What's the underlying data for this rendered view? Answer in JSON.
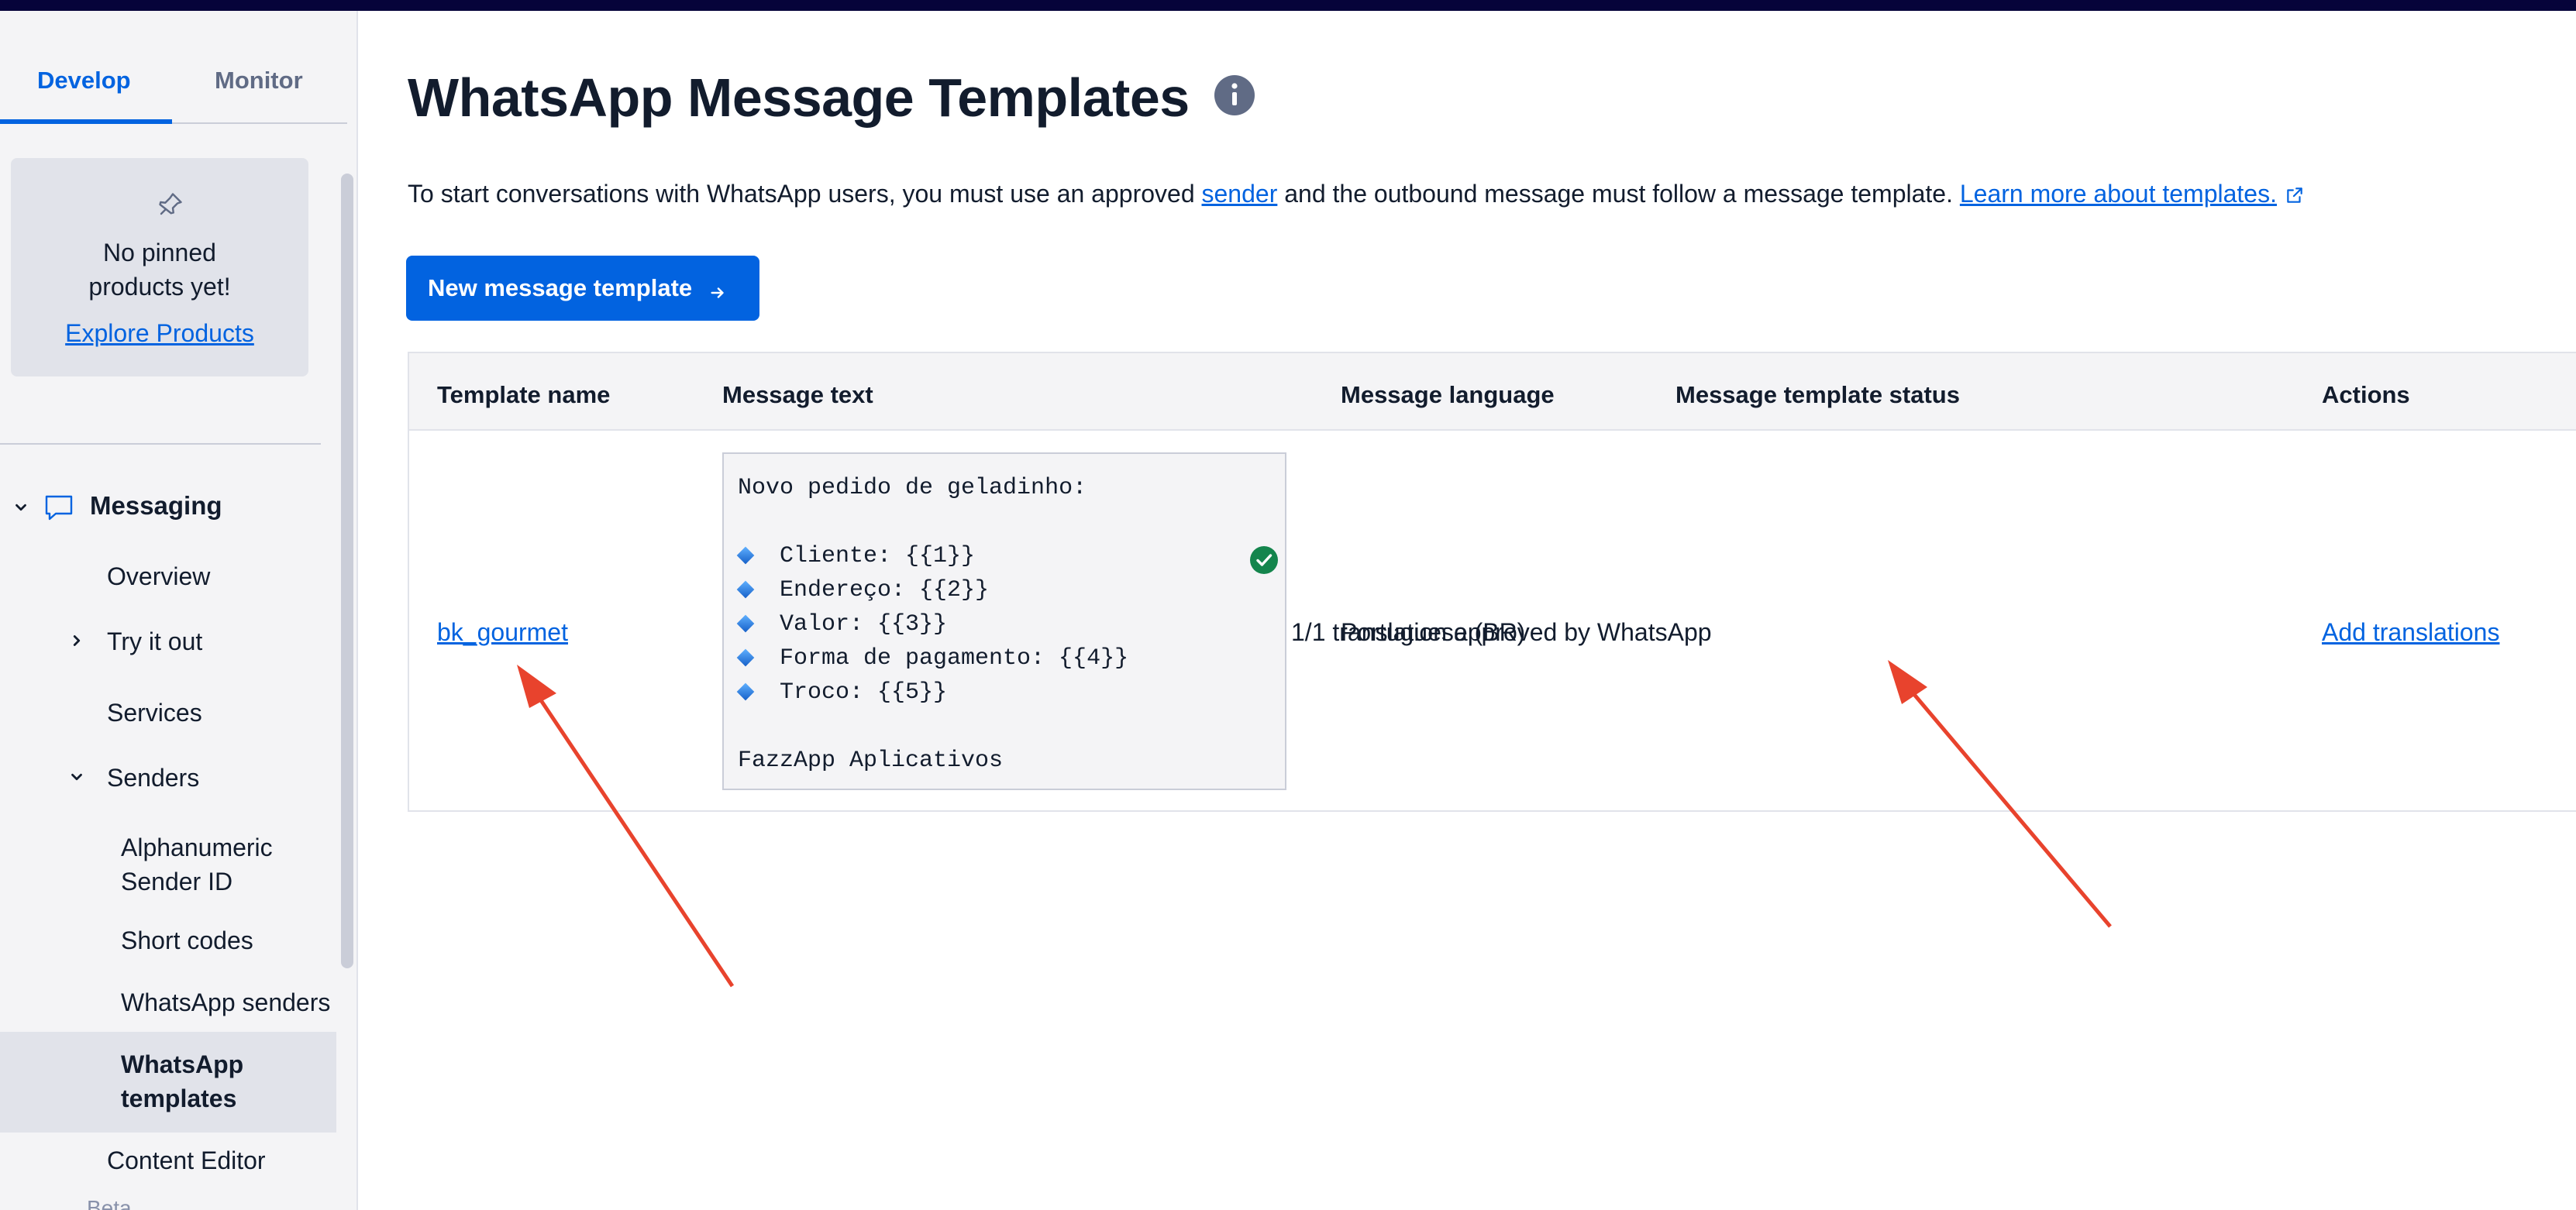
{
  "sidebar": {
    "tabs": [
      {
        "label": "Develop",
        "active": true
      },
      {
        "label": "Monitor",
        "active": false
      }
    ],
    "pinned": {
      "line1": "No pinned",
      "line2": "products yet!",
      "explore_label": "Explore Products"
    },
    "messaging": {
      "label": "Messaging",
      "overview": "Overview",
      "try_it_out": "Try it out",
      "services": "Services",
      "senders": "Senders",
      "alphanumeric_line1": "Alphanumeric",
      "alphanumeric_line2": "Sender ID",
      "short_codes": "Short codes",
      "whatsapp_senders": "WhatsApp senders",
      "whatsapp_templates_line1": "WhatsApp",
      "whatsapp_templates_line2": "templates",
      "content_editor": "Content Editor",
      "beta": "Beta"
    }
  },
  "page": {
    "title": "WhatsApp Message Templates",
    "intro_before": "To start conversations with WhatsApp users, you must use an approved ",
    "intro_link_sender": "sender",
    "intro_middle": " and the outbound message must follow a message template. ",
    "intro_link_learn": "Learn more about templates.",
    "new_button": "New message template"
  },
  "table": {
    "headers": {
      "name": "Template name",
      "text": "Message text",
      "language": "Message language",
      "status": "Message template status",
      "actions": "Actions"
    },
    "rows": [
      {
        "name": "bk_gourmet",
        "message_lines": [
          "Novo pedido de geladinho:",
          "",
          "Cliente: {{1}}",
          "Endereço: {{2}}",
          "Valor: {{3}}",
          "Forma de pagamento: {{4}}",
          "Troco: {{5}}",
          "",
          "FazzApp Aplicativos"
        ],
        "language": "Portuguese (BR)",
        "status": "1/1 translation approved by WhatsApp",
        "action": "Add translations"
      }
    ]
  },
  "colors": {
    "accent": "#0263e0",
    "topbar": "#06033a",
    "status_ok": "#14854d",
    "annotation_arrow": "#e8432d"
  }
}
